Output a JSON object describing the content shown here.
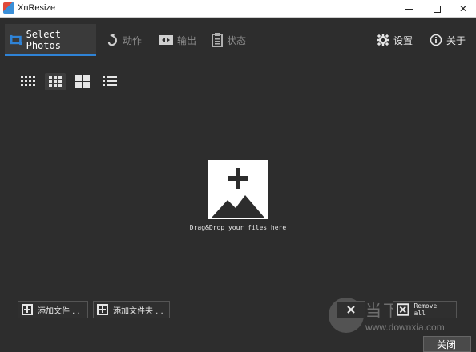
{
  "window": {
    "title": "XnResize"
  },
  "tabs": {
    "select_photos": "Select Photos",
    "action": "动作",
    "output": "输出",
    "status": "状态",
    "settings": "设置",
    "about": "关于"
  },
  "view_modes": [
    "small-grid",
    "medium-grid",
    "large-grid",
    "list"
  ],
  "drop_zone": {
    "text": "Drag&Drop your files here"
  },
  "buttons": {
    "add_file": "添加文件 . .",
    "add_folder": "添加文件夹 . .",
    "remove_all": "Remove all",
    "close": "关闭"
  },
  "watermark": {
    "text": "当下软件园",
    "url": "www.downxia.com"
  },
  "colors": {
    "accent": "#2f83d6",
    "background": "#2d2d2d"
  }
}
